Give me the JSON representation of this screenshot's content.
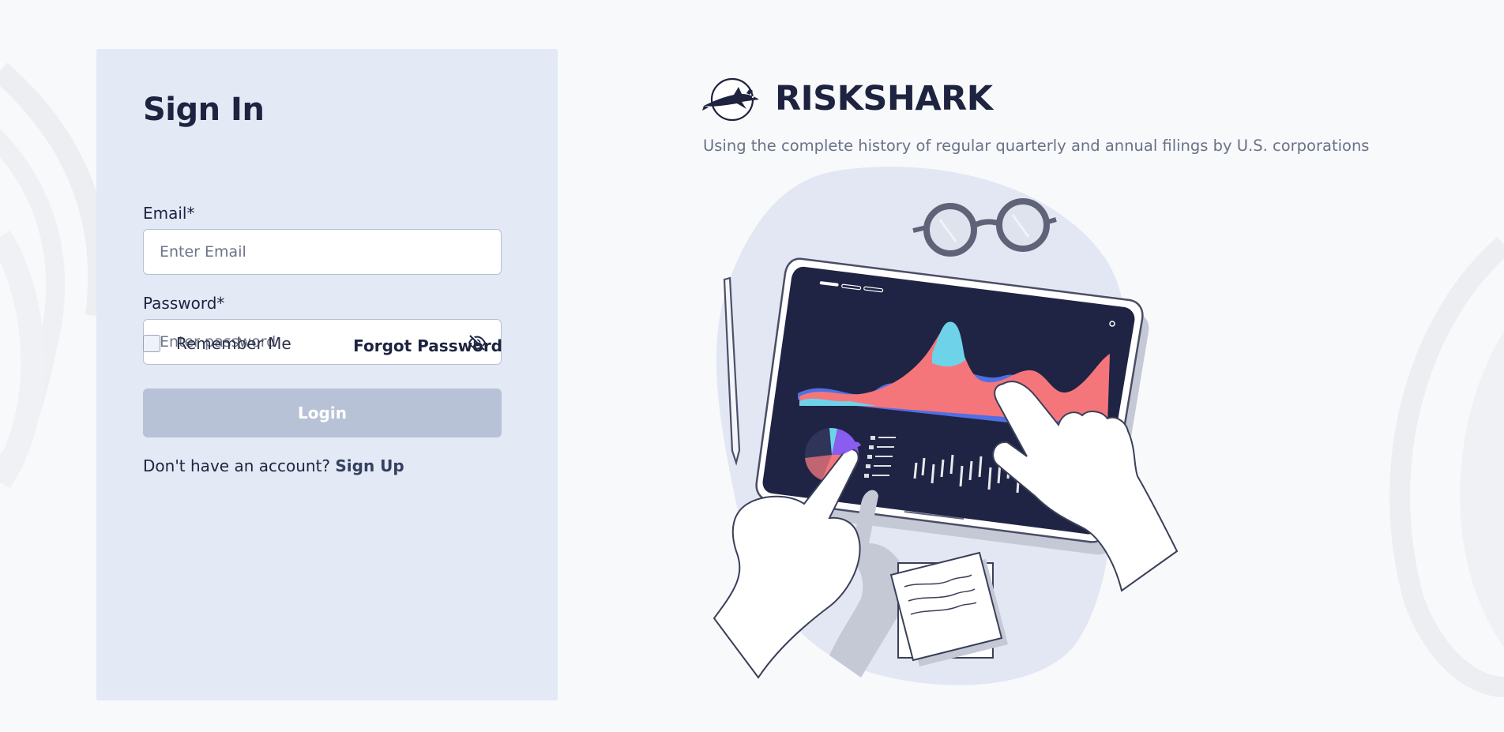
{
  "signin": {
    "title": "Sign In",
    "email_label": "Email*",
    "email_placeholder": "Enter Email",
    "email_value": "",
    "password_label": "Password*",
    "password_placeholder": "Enter password",
    "password_value": "",
    "password_toggle_icon": "eye-slash-icon",
    "remember_label": "Remember Me",
    "remember_checked": false,
    "forgot_label": "Forgot Password",
    "login_label": "Login",
    "signup_prompt": "Don't have an account?",
    "signup_label": "Sign Up"
  },
  "brand": {
    "name": "RISKSHARK",
    "logo_icon": "hammerhead-shark-icon",
    "tagline": "Using the complete history of regular quarterly and annual filings by U.S. corporations"
  },
  "colors": {
    "background": "#f7f9fb",
    "card_background": "#e3e9f5",
    "heading_text": "#1e2340",
    "login_button_disabled": "#b8c2d6",
    "tablet_screen": "#1f2444",
    "chart_coral": "#f4767b",
    "chart_blue": "#4f6fe3",
    "chart_cyan": "#6ed3e8"
  }
}
